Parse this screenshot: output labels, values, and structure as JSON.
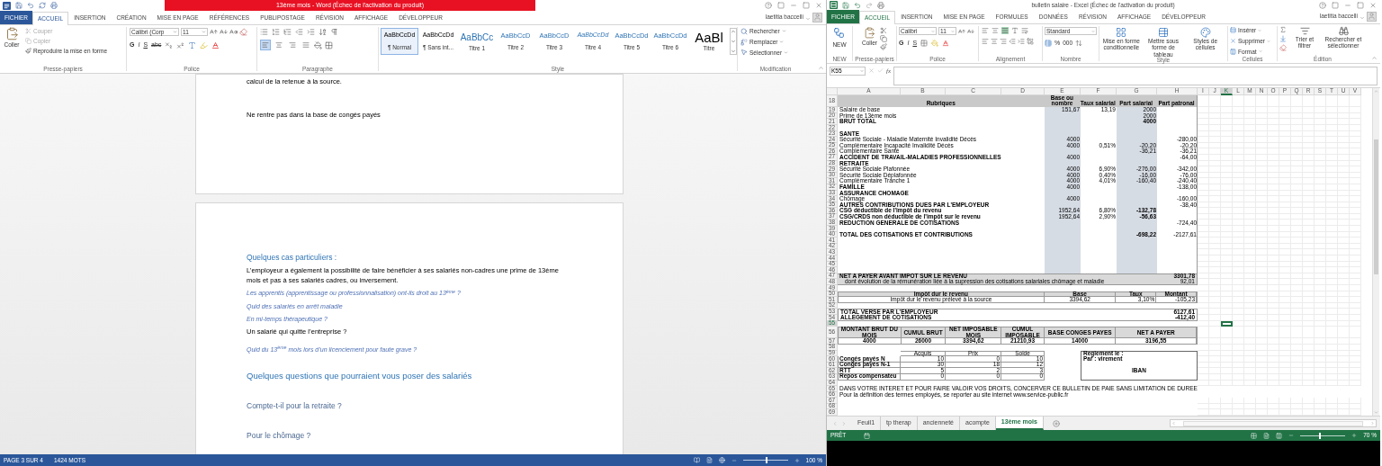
{
  "word": {
    "title": "13ème mois - Word (Échec de l'activation du produit)",
    "user": "laetitia baccelli",
    "tabs": [
      {
        "label": "FICHIER",
        "kind": "file",
        "selected": false
      },
      {
        "label": "ACCUEIL",
        "kind": "tab",
        "selected": true
      },
      {
        "label": "INSERTION",
        "kind": "tab",
        "selected": false
      },
      {
        "label": "CRÉATION",
        "kind": "tab",
        "selected": false
      },
      {
        "label": "MISE EN PAGE",
        "kind": "tab",
        "selected": false
      },
      {
        "label": "RÉFÉRENCES",
        "kind": "tab",
        "selected": false
      },
      {
        "label": "PUBLIPOSTAGE",
        "kind": "tab",
        "selected": false
      },
      {
        "label": "RÉVISION",
        "kind": "tab",
        "selected": false
      },
      {
        "label": "AFFICHAGE",
        "kind": "tab",
        "selected": false
      },
      {
        "label": "DÉVELOPPEUR",
        "kind": "tab",
        "selected": false
      }
    ],
    "clipboard": {
      "group": "Presse-papiers",
      "paste": "Coller",
      "actions": [
        {
          "kind": "cut",
          "label": "Couper",
          "disabled": true
        },
        {
          "kind": "copy",
          "label": "Copier",
          "disabled": true
        },
        {
          "kind": "format_painter",
          "label": "Reproduire la mise en forme",
          "disabled": false
        }
      ]
    },
    "font": {
      "group": "Police",
      "name": "Calibri (Corp",
      "size": "11",
      "format_buttons": [
        "G",
        "I",
        "S",
        "abc"
      ]
    },
    "paragraph": {
      "group": "Paragraphe",
      "alignments": [
        {
          "kind": "left",
          "selected": true
        },
        {
          "kind": "center",
          "selected": false
        },
        {
          "kind": "right",
          "selected": false
        },
        {
          "kind": "justify",
          "selected": false
        }
      ]
    },
    "styles": {
      "group": "Style",
      "items": [
        {
          "preview": "AaBbCcDd",
          "name": "¶ Normal",
          "kind": "body",
          "selected": true
        },
        {
          "preview": "AaBbCcDd",
          "name": "¶ Sans int...",
          "kind": "body",
          "selected": false
        },
        {
          "preview": "AaBbCc",
          "name": "Titre 1",
          "kind": "heading1",
          "selected": false
        },
        {
          "preview": "AaBbCcD",
          "name": "Titre 2",
          "kind": "heading",
          "selected": false
        },
        {
          "preview": "AaBbCcD",
          "name": "Titre 3",
          "kind": "heading",
          "selected": false
        },
        {
          "preview": "AaBbCcDd",
          "name": "Titre 4",
          "kind": "heading_italic",
          "selected": false
        },
        {
          "preview": "AaBbCcDd",
          "name": "Titre 5",
          "kind": "heading",
          "selected": false
        },
        {
          "preview": "AaBbCcDd",
          "name": "Titre 6",
          "kind": "heading",
          "selected": false
        },
        {
          "preview": "AaBl",
          "name": "Titre",
          "kind": "title",
          "selected": false
        }
      ]
    },
    "editing": {
      "group": "Modification",
      "actions": [
        {
          "kind": "find",
          "label": "Rechercher"
        },
        {
          "kind": "replace",
          "label": "Remplacer"
        },
        {
          "kind": "select",
          "label": "Sélectionner"
        }
      ]
    },
    "pages": [
      {
        "lines": [
          {
            "kind": "body",
            "text": "calcul de la retenue à la source."
          },
          {
            "kind": "body_spaced",
            "text": "Ne rentre pas dans la base de congés payés"
          }
        ]
      },
      {
        "lines": [
          {
            "kind": "heading",
            "text": "Quelques cas particuliers :"
          },
          {
            "kind": "body",
            "text": "L’employeur a également la possibilité de faire bénéficier à ses salariés non-cadres une prime de 13ème mois et pas à ses salariés cadres, ou inversement."
          },
          {
            "kind": "question",
            "text": "Les apprentis (apprentissage ou professionnalisation) ont-ils droit au 13$^{ème}$ ?"
          },
          {
            "kind": "question",
            "text": "Quid des salariés en arrêt maladie"
          },
          {
            "kind": "question",
            "text": "En mi-temps thérapeutique ?"
          },
          {
            "kind": "body",
            "text": "Un salarié qui quitte l’entreprise ?"
          },
          {
            "kind": "question_spaced",
            "text": "Quid du 13$^{ème}$ mois lors d’un licenciement pour faute grave ?"
          },
          {
            "kind": "heading2",
            "text": "Quelques questions que pourraient vous poser des salariés"
          },
          {
            "kind": "subheading",
            "text": "Compte-t-il pour la retraite ?"
          },
          {
            "kind": "subheading",
            "text": "Pour le chômage ?"
          }
        ]
      }
    ],
    "status_bar": {
      "page": "PAGE 3 SUR 4",
      "words": "1424 MOTS",
      "zoom": "100 %",
      "zoom_slider": {
        "level": 0.5
      }
    }
  },
  "excel": {
    "title": "bulletin salaire - Excel (Échec de l'activation du produit)",
    "user": "laetitia baccelli",
    "tabs": [
      {
        "label": "FICHIER",
        "kind": "file",
        "selected": false
      },
      {
        "label": "ACCUEIL",
        "kind": "tab",
        "selected": true
      },
      {
        "label": "INSERTION",
        "kind": "tab",
        "selected": false
      },
      {
        "label": "MISE EN PAGE",
        "kind": "tab",
        "selected": false
      },
      {
        "label": "FORMULES",
        "kind": "tab",
        "selected": false
      },
      {
        "label": "DONNÉES",
        "kind": "tab",
        "selected": false
      },
      {
        "label": "RÉVISION",
        "kind": "tab",
        "selected": false
      },
      {
        "label": "AFFICHAGE",
        "kind": "tab",
        "selected": false
      },
      {
        "label": "DÉVELOPPEUR",
        "kind": "tab",
        "selected": false
      }
    ],
    "ribbon": {
      "new": {
        "label": "NEW",
        "group": "NEW"
      },
      "clipboard": {
        "paste": "Coller",
        "group": "Presse-papiers"
      },
      "font": {
        "name": "Calibri",
        "size": "11",
        "format_buttons": [
          "G",
          "I",
          "S"
        ],
        "group": "Police"
      },
      "alignment": {
        "group": "Alignement"
      },
      "number": {
        "format": "Standard",
        "percent": "%",
        "thousands": "000",
        "group": "Nombre"
      },
      "styles": {
        "buttons": [
          "Mise en forme conditionnelle",
          "Mettre sous forme de tableau",
          "Styles de cellules"
        ],
        "group": "Style"
      },
      "cells": {
        "buttons": [
          "Insérer",
          "Supprimer",
          "Format"
        ],
        "group": "Cellules"
      },
      "editing": {
        "buttons": [
          "Trier et filtrer",
          "Rechercher et sélectionner"
        ],
        "group": "Édition"
      }
    },
    "name_box": "K55",
    "function_label": "fx",
    "columns": [
      {
        "label": "A",
        "selected": false
      },
      {
        "label": "B",
        "selected": false
      },
      {
        "label": "C",
        "selected": false
      },
      {
        "label": "D",
        "selected": false
      },
      {
        "label": "E",
        "selected": false
      },
      {
        "label": "F",
        "selected": false
      },
      {
        "label": "G",
        "selected": false
      },
      {
        "label": "H",
        "selected": false
      },
      {
        "label": "I",
        "selected": false
      },
      {
        "label": "J",
        "selected": false
      },
      {
        "label": "K",
        "selected": true
      },
      {
        "label": "L",
        "selected": false
      },
      {
        "label": "M",
        "selected": false
      },
      {
        "label": "N",
        "selected": false
      },
      {
        "label": "O",
        "selected": false
      },
      {
        "label": "P",
        "selected": false
      },
      {
        "label": "Q",
        "selected": false
      },
      {
        "label": "R",
        "selected": false
      },
      {
        "label": "S",
        "selected": false
      },
      {
        "label": "T",
        "selected": false
      },
      {
        "label": "U",
        "selected": false
      },
      {
        "label": "V",
        "selected": false
      }
    ],
    "sections": [
      {
        "kind": "payroll",
        "header": {
          "num": "18",
          "selected": false,
          "cells": [
            "Rubriques",
            "Base ou nombre",
            "Taux salarial",
            "Part salarial",
            "Part patronal"
          ]
        },
        "rows": [
          {
            "num": "19",
            "selected": false,
            "label": "Salaire de base",
            "bold": false,
            "base": "151,67",
            "rate": "13,19",
            "employee": "2000"
          },
          {
            "num": "20",
            "selected": false,
            "label": "Prime de 13ème mois",
            "bold": false,
            "employee": "2000"
          },
          {
            "num": "21",
            "selected": false,
            "label": "BRUT TOTAL",
            "bold": true,
            "employee": "4000"
          },
          {
            "num": "22",
            "selected": false
          },
          {
            "num": "23",
            "selected": false,
            "label": "SANTE",
            "bold": true
          },
          {
            "num": "24",
            "selected": false,
            "label": "Sécurité Sociale - Maladie Maternité Invalidité Décès",
            "bold": false,
            "base": "4000",
            "employer": "-280,00"
          },
          {
            "num": "25",
            "selected": false,
            "label": "Complémentaire Incapacité Invalidité Décès",
            "bold": false,
            "base": "4000",
            "rate": "0,51%",
            "employee": "-20,20",
            "employer": "-20,20"
          },
          {
            "num": "26",
            "selected": false,
            "label": "Complémentaire Santé",
            "bold": false,
            "employee": "-36,21",
            "employer": "-36,21"
          },
          {
            "num": "27",
            "selected": false,
            "label": "ACCIDENT DE TRAVAIL-MALADIES PROFESSIONNELLES",
            "bold": true,
            "base": "4000",
            "employer": "-64,00"
          },
          {
            "num": "28",
            "selected": false,
            "label": "RETRAITE",
            "bold": true
          },
          {
            "num": "29",
            "selected": false,
            "label": "Sécurité Sociale Plafonnée",
            "bold": false,
            "base": "4000",
            "rate": "6,90%",
            "employee": "-276,00",
            "employer": "-342,00"
          },
          {
            "num": "30",
            "selected": false,
            "label": "Sécurité Sociale Déplafonnée",
            "bold": false,
            "base": "4000",
            "rate": "0,40%",
            "employee": "-16,00",
            "employer": "-76,00"
          },
          {
            "num": "31",
            "selected": false,
            "label": "Complémentaire Tranche 1",
            "bold": false,
            "base": "4000",
            "rate": "4,01%",
            "employee": "-160,40",
            "employer": "-240,40"
          },
          {
            "num": "32",
            "selected": false,
            "label": "FAMILLE",
            "bold": true,
            "base": "4000",
            "employer": "-138,00"
          },
          {
            "num": "33",
            "selected": false,
            "label": "ASSURANCE CHOMAGE",
            "bold": true
          },
          {
            "num": "34",
            "selected": false,
            "label": "Chômage",
            "bold": false,
            "base": "4000",
            "employer": "-160,00"
          },
          {
            "num": "35",
            "selected": false,
            "label": "AUTRES CONTRIBUTIONS DUES PAR L'EMPLOYEUR",
            "bold": true,
            "employer": "-38,40"
          },
          {
            "num": "36",
            "selected": false,
            "label": "CSG déductible de l'impôt du revenu",
            "bold": true,
            "base": "1952,64",
            "rate": "6,80%",
            "employee": "-132,78"
          },
          {
            "num": "37",
            "selected": false,
            "label": "CSG/CRDS non déductible de l'impôt sur le revenu",
            "bold": true,
            "base": "1952,64",
            "rate": "2,90%",
            "employee": "-56,63"
          },
          {
            "num": "38",
            "selected": false,
            "label": "REDUCTION GENERALE DE COTISATIONS",
            "bold": true,
            "employer": "-724,40"
          },
          {
            "num": "39",
            "selected": false
          },
          {
            "num": "40",
            "selected": false,
            "label": "TOTAL DES COTISATIONS ET CONTRIBUTIONS",
            "bold": true,
            "employee": "-698,22",
            "employer": "-2127,61"
          },
          {
            "num": "41",
            "selected": false
          },
          {
            "num": "42",
            "selected": false
          },
          {
            "num": "43",
            "selected": false
          },
          {
            "num": "44",
            "selected": false
          },
          {
            "num": "45",
            "selected": false
          },
          {
            "num": "46",
            "selected": false
          }
        ]
      },
      {
        "kind": "band",
        "rows": [
          {
            "num": "47",
            "selected": false,
            "label": "NET A PAYER AVANT IMPOT SUR LE REVENU",
            "value": "3301,78",
            "bold": true
          },
          {
            "num": "48",
            "selected": false,
            "label": "dont évolution de la rémunération liée à la supression des cotisations salariales chômage et maladie",
            "value": "92,01",
            "bold": false
          }
        ]
      },
      {
        "kind": "blank",
        "rows": [
          {
            "num": "49",
            "selected": false
          }
        ]
      },
      {
        "kind": "tax",
        "header": {
          "num": "50",
          "selected": false,
          "cells": [
            "Impôt dur le revenu",
            "Base",
            "Taux",
            "Montant"
          ]
        },
        "rows": [
          {
            "num": "51",
            "selected": false,
            "cells": [
              "Impôt dur le revenu prélevé à la source",
              "3394,62",
              "3,10%",
              "-105,23"
            ]
          }
        ]
      },
      {
        "kind": "blank",
        "rows": [
          {
            "num": "52",
            "selected": false
          }
        ]
      },
      {
        "kind": "totals",
        "rows": [
          {
            "num": "53",
            "selected": false,
            "label": "TOTAL VERSE PAR L'EMPLOYEUR",
            "value": "6127,61"
          },
          {
            "num": "54",
            "selected": false,
            "label": "ALLEGEMENT DE COTISATIONS",
            "value": "-412,40"
          }
        ]
      },
      {
        "kind": "blank",
        "rows": [
          {
            "num": "55",
            "selected": true
          }
        ]
      },
      {
        "kind": "summary",
        "header": {
          "num": "56",
          "selected": false,
          "cells": [
            "MONTANT BRUT DU MOIS",
            "CUMUL BRUT",
            "NET IMPOSABLE MOIS",
            "CUMUL IMPOSABLE",
            "BASE CONGES PAYES",
            "NET A PAYER"
          ]
        },
        "rows": [
          {
            "num": "57",
            "selected": false,
            "cells": [
              "4000",
              "26000",
              "3394,62",
              "21210,93",
              "14000",
              "3196,55"
            ]
          }
        ]
      },
      {
        "kind": "blank",
        "rows": [
          {
            "num": "58",
            "selected": false
          }
        ]
      },
      {
        "kind": "leave",
        "header": {
          "num": "59",
          "selected": false,
          "cells": [
            "Acquis",
            "Prix",
            "Solde"
          ],
          "payment": "Reglement le :"
        },
        "rows": [
          {
            "num": "60",
            "selected": false,
            "label": "Congés payés N",
            "cells": [
              "10",
              "0",
              "10"
            ],
            "payment": "Par : virement"
          },
          {
            "num": "61",
            "selected": false,
            "label": "Congés payés N-1",
            "cells": [
              "30",
              "18",
              "12"
            ]
          },
          {
            "num": "62",
            "selected": false,
            "label": "RTT",
            "cells": [
              "5",
              "2",
              "3"
            ],
            "payment": "IBAN"
          },
          {
            "num": "63",
            "selected": false,
            "label": "Repos compensateu",
            "cells": [
              "0",
              "0",
              "0"
            ]
          }
        ]
      },
      {
        "kind": "blank",
        "rows": [
          {
            "num": "64",
            "selected": false
          }
        ]
      },
      {
        "kind": "note",
        "rows": [
          {
            "num": "65",
            "selected": false,
            "text": "DANS VOTRE INTERET ET POUR FAIRE VALOIR VOS DROITS, CONCERVER CE BULLETIN DE PAIE SANS LIMITATION DE DUREE"
          },
          {
            "num": "66",
            "selected": false,
            "text": "Pour la définition des termes employés, se reporter au site internet www.service-public.fr"
          }
        ]
      },
      {
        "kind": "blank",
        "rows": [
          {
            "num": "67",
            "selected": false
          },
          {
            "num": "68",
            "selected": false
          },
          {
            "num": "69",
            "selected": false
          }
        ]
      }
    ],
    "sheet_tabs": [
      {
        "label": "Feuil1",
        "selected": false
      },
      {
        "label": "tp therap",
        "selected": false
      },
      {
        "label": "ancienneté",
        "selected": false
      },
      {
        "label": "acompte",
        "selected": false
      },
      {
        "label": "13ème mois",
        "selected": true
      }
    ],
    "status_bar": {
      "mode": "PRÊT",
      "zoom": "70 %",
      "zoom_slider": {
        "level": 0.42
      }
    }
  }
}
